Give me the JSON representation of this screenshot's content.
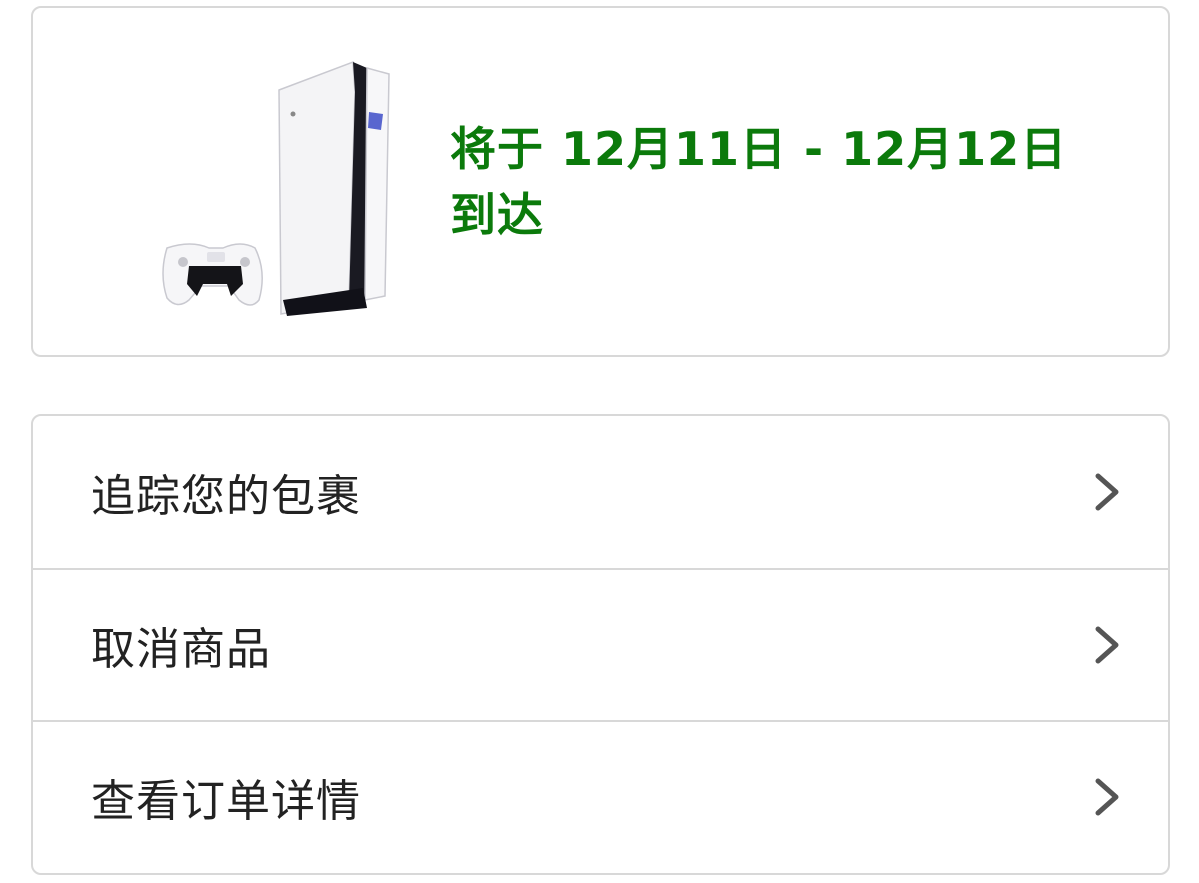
{
  "delivery": {
    "message": "将于 12月11日 - 12月12日 到达",
    "accent_color": "#0b7a0b",
    "product_icon": "game-console-with-controller"
  },
  "actions": [
    {
      "label": "追踪您的包裹",
      "icon": "chevron-right-icon"
    },
    {
      "label": "取消商品",
      "icon": "chevron-right-icon"
    },
    {
      "label": "查看订单详情",
      "icon": "chevron-right-icon"
    }
  ]
}
